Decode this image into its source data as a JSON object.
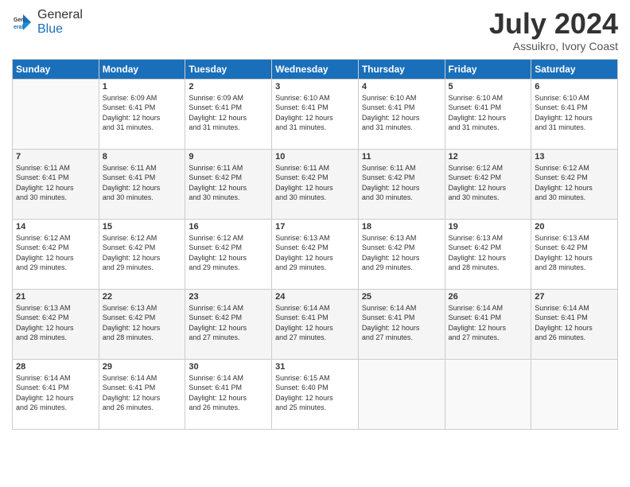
{
  "header": {
    "logo_general": "General",
    "logo_blue": "Blue",
    "month_title": "July 2024",
    "location": "Assuikro, Ivory Coast"
  },
  "days_of_week": [
    "Sunday",
    "Monday",
    "Tuesday",
    "Wednesday",
    "Thursday",
    "Friday",
    "Saturday"
  ],
  "weeks": [
    [
      {
        "num": "",
        "info": ""
      },
      {
        "num": "1",
        "info": "Sunrise: 6:09 AM\nSunset: 6:41 PM\nDaylight: 12 hours\nand 31 minutes."
      },
      {
        "num": "2",
        "info": "Sunrise: 6:09 AM\nSunset: 6:41 PM\nDaylight: 12 hours\nand 31 minutes."
      },
      {
        "num": "3",
        "info": "Sunrise: 6:10 AM\nSunset: 6:41 PM\nDaylight: 12 hours\nand 31 minutes."
      },
      {
        "num": "4",
        "info": "Sunrise: 6:10 AM\nSunset: 6:41 PM\nDaylight: 12 hours\nand 31 minutes."
      },
      {
        "num": "5",
        "info": "Sunrise: 6:10 AM\nSunset: 6:41 PM\nDaylight: 12 hours\nand 31 minutes."
      },
      {
        "num": "6",
        "info": "Sunrise: 6:10 AM\nSunset: 6:41 PM\nDaylight: 12 hours\nand 31 minutes."
      }
    ],
    [
      {
        "num": "7",
        "info": "Sunrise: 6:11 AM\nSunset: 6:41 PM\nDaylight: 12 hours\nand 30 minutes."
      },
      {
        "num": "8",
        "info": "Sunrise: 6:11 AM\nSunset: 6:41 PM\nDaylight: 12 hours\nand 30 minutes."
      },
      {
        "num": "9",
        "info": "Sunrise: 6:11 AM\nSunset: 6:42 PM\nDaylight: 12 hours\nand 30 minutes."
      },
      {
        "num": "10",
        "info": "Sunrise: 6:11 AM\nSunset: 6:42 PM\nDaylight: 12 hours\nand 30 minutes."
      },
      {
        "num": "11",
        "info": "Sunrise: 6:11 AM\nSunset: 6:42 PM\nDaylight: 12 hours\nand 30 minutes."
      },
      {
        "num": "12",
        "info": "Sunrise: 6:12 AM\nSunset: 6:42 PM\nDaylight: 12 hours\nand 30 minutes."
      },
      {
        "num": "13",
        "info": "Sunrise: 6:12 AM\nSunset: 6:42 PM\nDaylight: 12 hours\nand 30 minutes."
      }
    ],
    [
      {
        "num": "14",
        "info": "Sunrise: 6:12 AM\nSunset: 6:42 PM\nDaylight: 12 hours\nand 29 minutes."
      },
      {
        "num": "15",
        "info": "Sunrise: 6:12 AM\nSunset: 6:42 PM\nDaylight: 12 hours\nand 29 minutes."
      },
      {
        "num": "16",
        "info": "Sunrise: 6:12 AM\nSunset: 6:42 PM\nDaylight: 12 hours\nand 29 minutes."
      },
      {
        "num": "17",
        "info": "Sunrise: 6:13 AM\nSunset: 6:42 PM\nDaylight: 12 hours\nand 29 minutes."
      },
      {
        "num": "18",
        "info": "Sunrise: 6:13 AM\nSunset: 6:42 PM\nDaylight: 12 hours\nand 29 minutes."
      },
      {
        "num": "19",
        "info": "Sunrise: 6:13 AM\nSunset: 6:42 PM\nDaylight: 12 hours\nand 28 minutes."
      },
      {
        "num": "20",
        "info": "Sunrise: 6:13 AM\nSunset: 6:42 PM\nDaylight: 12 hours\nand 28 minutes."
      }
    ],
    [
      {
        "num": "21",
        "info": "Sunrise: 6:13 AM\nSunset: 6:42 PM\nDaylight: 12 hours\nand 28 minutes."
      },
      {
        "num": "22",
        "info": "Sunrise: 6:13 AM\nSunset: 6:42 PM\nDaylight: 12 hours\nand 28 minutes."
      },
      {
        "num": "23",
        "info": "Sunrise: 6:14 AM\nSunset: 6:42 PM\nDaylight: 12 hours\nand 27 minutes."
      },
      {
        "num": "24",
        "info": "Sunrise: 6:14 AM\nSunset: 6:41 PM\nDaylight: 12 hours\nand 27 minutes."
      },
      {
        "num": "25",
        "info": "Sunrise: 6:14 AM\nSunset: 6:41 PM\nDaylight: 12 hours\nand 27 minutes."
      },
      {
        "num": "26",
        "info": "Sunrise: 6:14 AM\nSunset: 6:41 PM\nDaylight: 12 hours\nand 27 minutes."
      },
      {
        "num": "27",
        "info": "Sunrise: 6:14 AM\nSunset: 6:41 PM\nDaylight: 12 hours\nand 26 minutes."
      }
    ],
    [
      {
        "num": "28",
        "info": "Sunrise: 6:14 AM\nSunset: 6:41 PM\nDaylight: 12 hours\nand 26 minutes."
      },
      {
        "num": "29",
        "info": "Sunrise: 6:14 AM\nSunset: 6:41 PM\nDaylight: 12 hours\nand 26 minutes."
      },
      {
        "num": "30",
        "info": "Sunrise: 6:14 AM\nSunset: 6:41 PM\nDaylight: 12 hours\nand 26 minutes."
      },
      {
        "num": "31",
        "info": "Sunrise: 6:15 AM\nSunset: 6:40 PM\nDaylight: 12 hours\nand 25 minutes."
      },
      {
        "num": "",
        "info": ""
      },
      {
        "num": "",
        "info": ""
      },
      {
        "num": "",
        "info": ""
      }
    ]
  ]
}
